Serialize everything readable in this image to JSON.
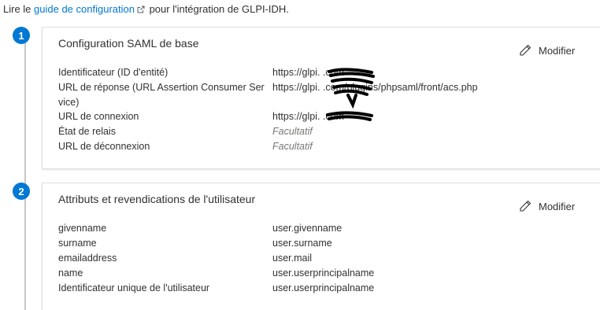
{
  "intro": {
    "prefix": "Lire le ",
    "link": "guide de configuration",
    "suffix": " pour l'intégration de GLPI-IDH."
  },
  "sections": [
    {
      "step": "1",
      "title": "Configuration SAML de base",
      "edit_label": "Modifier",
      "rows": [
        {
          "label": "Identificateur (ID d'entité)",
          "value": "https://glpi.          .com"
        },
        {
          "label": "URL de réponse (URL Assertion Consumer Ser vice)",
          "value": "https://glpi.          .com/plugins/phpsaml/front/acs.php"
        },
        {
          "label": "URL de connexion",
          "value": "https://glpi.          .com"
        },
        {
          "label": "État de relais",
          "value": "Facultatif"
        },
        {
          "label": "URL de déconnexion",
          "value": "Facultatif"
        }
      ]
    },
    {
      "step": "2",
      "title": "Attributs et revendications de l'utilisateur",
      "edit_label": "Modifier",
      "rows": [
        {
          "label": "givenname",
          "value": "user.givenname"
        },
        {
          "label": "surname",
          "value": "user.surname"
        },
        {
          "label": "emailaddress",
          "value": "user.mail"
        },
        {
          "label": "name",
          "value": "user.userprincipalname"
        },
        {
          "label": "Identificateur unique de l'utilisateur",
          "value": "user.userprincipalname"
        }
      ]
    }
  ],
  "colors": {
    "accent": "#0078d4",
    "text": "#323130",
    "muted": "#797775",
    "border": "#e1dfdd"
  },
  "icons": {
    "external_link": "external-link-icon",
    "edit": "pencil-icon"
  }
}
